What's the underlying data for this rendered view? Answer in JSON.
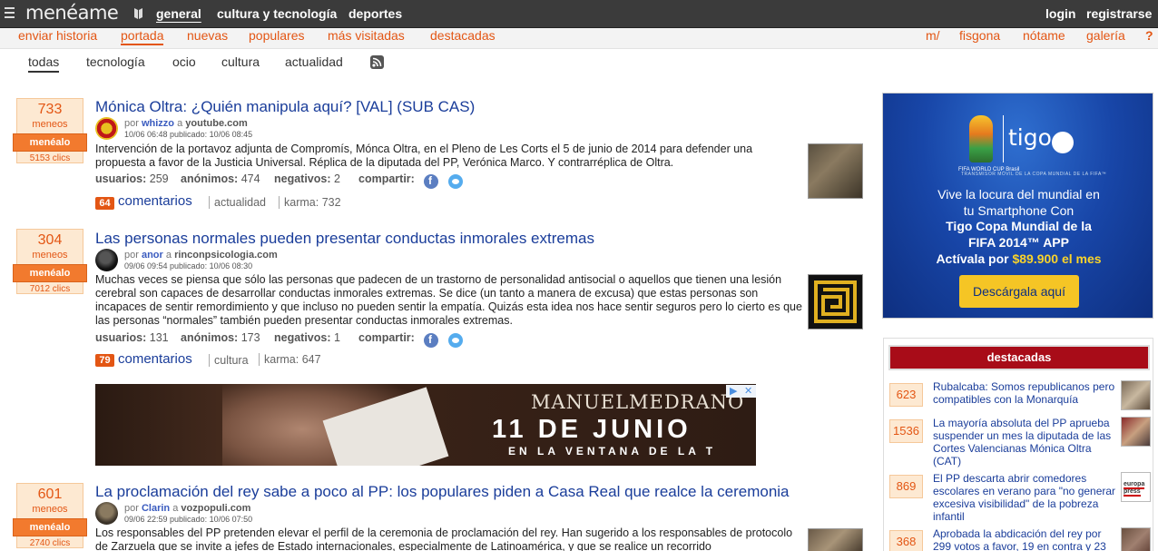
{
  "header": {
    "logo": "menéame",
    "nav": [
      "general",
      "cultura y tecnología",
      "deportes"
    ],
    "login": "login",
    "register": "registrarse"
  },
  "subnav": {
    "left": [
      "enviar historia",
      "portada",
      "nuevas",
      "populares",
      "más visitadas",
      "destacadas"
    ],
    "right": [
      "m/",
      "fisgona",
      "nótame",
      "galería",
      "?"
    ]
  },
  "categories": [
    "todas",
    "tecnología",
    "ocio",
    "cultura",
    "actualidad"
  ],
  "vote_label": "meneos",
  "menealo_label": "menéalo",
  "stats_labels": {
    "users": "usuarios:",
    "anon": "anónimos:",
    "neg": "negativos:",
    "share": "compartir:",
    "comments": "comentarios",
    "karma": "karma:"
  },
  "stories": [
    {
      "votes": "733",
      "clicks": "5153 clics",
      "title": "Mónica Oltra: ¿Quién manipula aquí? [VAL] (SUB CAS)",
      "by": "por",
      "user": "whizzo",
      "a": "a",
      "source": "youtube.com",
      "dates": "10/06 06:48 publicado: 10/06 08:45",
      "body": "Intervención de la portavoz adjunta de Compromís, Mónca Oltra, en el Pleno de Les Corts el 5 de junio de 2014 para defender una propuesta a favor de la Justicia Universal. Réplica de la diputada del PP, Verónica Marco. Y contrarréplica de Oltra.",
      "users": "259",
      "anon": "474",
      "neg": "2",
      "comments": "64",
      "category": "actualidad",
      "karma": "732"
    },
    {
      "votes": "304",
      "clicks": "7012 clics",
      "title": "Las personas normales pueden presentar conductas inmorales extremas",
      "by": "por",
      "user": "anor",
      "a": "a",
      "source": "rinconpsicologia.com",
      "dates": "09/06 09:54 publicado: 10/06 08:30",
      "body": "Muchas veces se piensa que sólo las personas que padecen de un trastorno de personalidad antisocial o aquellos que tienen una lesión cerebral son capaces de desarrollar conductas inmorales extremas. Se dice (un tanto a manera de excusa) que estas personas son incapaces de sentir remordimiento y que incluso no pueden sentir la empatía. Quizás esta idea nos hace sentir seguros pero lo cierto es que las personas “normales” también pueden presentar conductas inmorales extremas.",
      "users": "131",
      "anon": "173",
      "neg": "1",
      "comments": "79",
      "category": "cultura",
      "karma": "647"
    },
    {
      "votes": "601",
      "clicks": "2740 clics",
      "title": "La proclamación del rey sabe a poco al PP: los populares piden a Casa Real que realce la ceremonia",
      "by": "por",
      "user": "Clarin",
      "a": "a",
      "source": "vozpopuli.com",
      "dates": "09/06 22:59 publicado: 10/06 07:50",
      "body": "Los responsables del PP pretenden elevar el perfil de la ceremonia de proclamación del rey. Han sugerido a los responsables de protocolo de Zarzuela que se invite a jefes de Estado internacionales, especialmente de Latinoamérica, y que se realice un recorrido"
    }
  ],
  "mid_ad": {
    "brand": "MANUELMEDRANO",
    "date": "11 DE JUNIO",
    "sub": "EN LA VENTANA DE LA T"
  },
  "side_ad": {
    "tigo": "tigo",
    "fwc_label": "FIFA WORLD CUP Brasil",
    "tagline": "TRANSMISOR MÓVIL DE LA COPA MUNDIAL DE LA FIFA™",
    "line1": "Vive la locura del mundial en",
    "line2": "tu Smartphone Con",
    "line3": "Tigo Copa Mundial de la",
    "line4": "FIFA 2014™ APP",
    "line5a": "Actívala por ",
    "line5b": "$89.900 el mes",
    "cta": "Descárgala aquí"
  },
  "destacadas": {
    "title": "destacadas",
    "items": [
      {
        "count": "623",
        "title": "Rubalcaba: Somos republicanos pero compatibles con la Monarquía"
      },
      {
        "count": "1536",
        "title": "La mayoría absoluta del PP aprueba suspender un mes la diputada de las Cortes Valencianas Mónica Oltra (CAT)"
      },
      {
        "count": "869",
        "title": "El PP descarta abrir comedores escolares en verano para \"no generar excesiva visibilidad\" de la pobreza infantil",
        "thumb_label": "europa press"
      },
      {
        "count": "368",
        "title": "Aprobada la abdicación del rey por 299 votos a favor, 19 en contra y 23"
      }
    ]
  },
  "colors": {
    "accent": "#e35614",
    "link": "#1a3d9a",
    "topbar": "#3b3b3b",
    "destacadas_head": "#a80c18"
  }
}
